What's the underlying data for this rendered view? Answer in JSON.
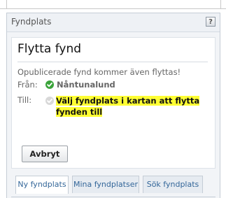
{
  "panel": {
    "title": "Fyndplats",
    "help_icon": "question-icon"
  },
  "card": {
    "title": "Flytta fynd",
    "info": "Opublicerade fynd kommer även flyttas!",
    "from_label": "Från:",
    "from_value": "Nåntunalund",
    "from_icon": "check-circle-icon",
    "to_label": "Till:",
    "to_value": "Välj fyndplats i kartan att flytta fynden till",
    "to_icon": "pending-circle-icon",
    "cancel_label": "Avbryt"
  },
  "tabs": [
    {
      "label": "Ny fyndplats",
      "active": true
    },
    {
      "label": "Mina fyndplatser",
      "active": false
    },
    {
      "label": "Sök fyndplats",
      "active": false
    }
  ],
  "colors": {
    "highlight": "#ffff33",
    "ok": "#3aa33a",
    "tab_text": "#336699"
  }
}
